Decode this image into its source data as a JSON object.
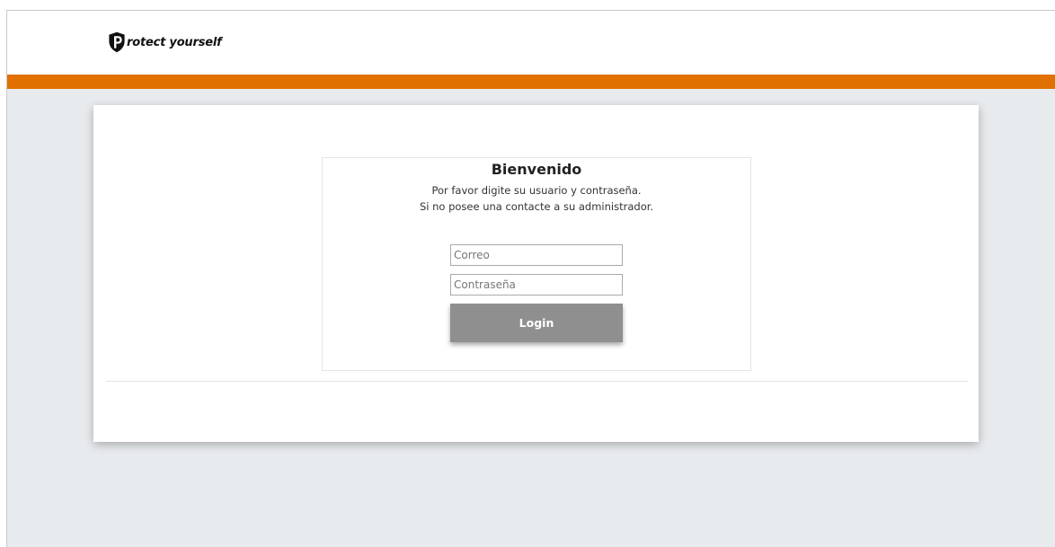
{
  "brand": {
    "logo_name": "shield-p-icon",
    "name": "rotect yourself"
  },
  "colors": {
    "accent": "#e07000",
    "background": "#e8ebee",
    "button": "#8f8f8f"
  },
  "login": {
    "title": "Bienvenido",
    "subtitle_line1": "Por favor digite su usuario y contraseña.",
    "subtitle_line2": "Si no posee una contacte a su administrador.",
    "email_placeholder": "Correo",
    "email_value": "",
    "password_placeholder": "Contraseña",
    "password_value": "",
    "button_label": "Login"
  }
}
